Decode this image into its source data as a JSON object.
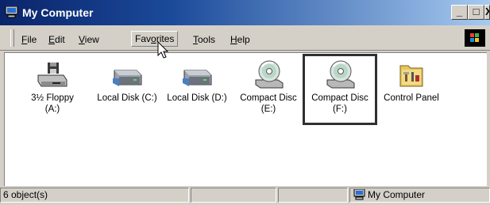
{
  "window": {
    "title": "My Computer",
    "title_icon": "computer-icon",
    "controls": {
      "minimize": "_",
      "maximize": "□",
      "close": "X"
    }
  },
  "menubar": {
    "items": [
      {
        "label": "File",
        "mnemonic": "F",
        "rest": "ile"
      },
      {
        "label": "Edit",
        "mnemonic": "E",
        "rest": "dit"
      },
      {
        "label": "View",
        "mnemonic": "V",
        "rest": "iew"
      },
      {
        "label": "Favorites",
        "pre": "Fav",
        "mnemonic": "o",
        "rest": "rites"
      },
      {
        "label": "Tools",
        "mnemonic": "T",
        "rest": "ools"
      },
      {
        "label": "Help",
        "mnemonic": "H",
        "rest": "elp"
      }
    ],
    "active": "Favorites"
  },
  "items": [
    {
      "label_line1": "3½ Floppy",
      "label_line2": "(A:)",
      "icon": "floppy-drive-icon"
    },
    {
      "label_line1": "Local Disk (C:)",
      "label_line2": "",
      "icon": "hard-disk-icon"
    },
    {
      "label_line1": "Local Disk (D:)",
      "label_line2": "",
      "icon": "hard-disk-icon"
    },
    {
      "label_line1": "Compact Disc",
      "label_line2": "(E:)",
      "icon": "cd-drive-icon"
    },
    {
      "label_line1": "Compact Disc",
      "label_line2": "(F:)",
      "icon": "cd-drive-icon",
      "selected": true
    },
    {
      "label_line1": "Control Panel",
      "label_line2": "",
      "icon": "control-panel-icon"
    }
  ],
  "statusbar": {
    "count": "6 object(s)",
    "location": "My Computer",
    "location_icon": "computer-icon"
  },
  "colors": {
    "titlebar_start": "#0a246a",
    "titlebar_end": "#a6caf0",
    "chrome": "#d4d0c8",
    "pane": "#ffffff"
  }
}
